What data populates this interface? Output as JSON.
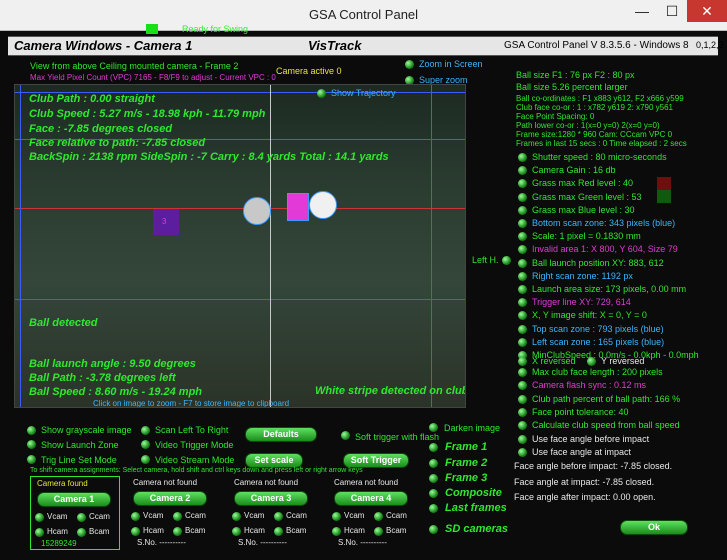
{
  "window": {
    "title": "GSA Control Panel",
    "min": "—",
    "max": "☐",
    "close": "✕"
  },
  "status": {
    "ready": "Ready for Swing"
  },
  "header": {
    "camera_title": "Camera Windows - Camera  1",
    "app_name": "VisTrack",
    "version": "GSA Control Panel V 8.3.5.6 - Windows 8",
    "id": "0,1,2,3"
  },
  "view": {
    "caption": "View from above Ceiling mounted camera - Frame 2",
    "pixel_count": "Max Yield Pixel Count (VPC) 7165  - F8/F9 to adjust - Current VPC : 0",
    "camera_active": "Camera active 0",
    "zoom_screen": "Zoom in Screen",
    "super_zoom": "Super zoom",
    "show_trajectory": "Show Trajectory"
  },
  "overlay": {
    "club_path": "Club Path : 0.00 straight",
    "club_speed": "Club Speed : 5.27 m/s - 18.98 kph - 11.79 mph",
    "face": "Face : -7.85 degrees closed",
    "face_rel": "Face relative to path: -7.85 closed",
    "spin": "BackSpin : 2138 rpm  SideSpin : -7  Carry : 8.4 yards  Total : 14.1 yards",
    "ball_detected": "Ball detected",
    "launch_angle": "Ball launch angle : 9.50 degrees",
    "ball_path": "Ball Path : -3.78 degrees left",
    "ball_speed": "Ball Speed : 8.60 m/s - 19.24 mph",
    "white_stripe": "White stripe detected on club",
    "store_hint": "Click on image to zoom - F7 to store image to clipboard",
    "ball_marker": "1",
    "ball_marker2": "3"
  },
  "info": {
    "ball_size1": "Ball size F1 : 76 px  F2 : 80 px",
    "ball_size2": "Ball size 5.26 percent larger",
    "coords1": "Ball co-ordinates : F1 x883 y612, F2 x666 y599",
    "coords2": "Club face co-or : 1 : x782 y619 2: x790 y561",
    "face_spacing": "Face Point Spacing: 0",
    "path_lower": "Path lower co-or : 1(x=0 y=0) 2(x=0 y=0)",
    "frame_size": "Frame size:1280 * 960 Cam: CCcam VPC 0",
    "frames": "Frames in last 15 secs : 0 Time elapsed : 2 secs"
  },
  "settings": [
    {
      "label": "Shutter speed : 80 micro-seconds",
      "color": "g"
    },
    {
      "label": "Camera Gain : 16 db",
      "color": "g"
    },
    {
      "label": "Grass max Red level : 40",
      "color": "g"
    },
    {
      "label": "Grass max Green level : 53",
      "color": "g"
    },
    {
      "label": "Grass max Blue level : 30",
      "color": "g"
    },
    {
      "label": "Bottom scan zone: 343 pixels (blue)",
      "color": "c"
    },
    {
      "label": "Scale: 1 pixel = 0.1830 mm",
      "color": "g"
    },
    {
      "label": "Invalid area 1: X 800, Y 604, Size 79",
      "color": "m"
    },
    {
      "label": "Ball launch position XY: 883, 612",
      "color": "g"
    },
    {
      "label": "Right scan zone: 1192 px",
      "color": "c"
    },
    {
      "label": "Launch area size: 173 pixels, 0.00 mm",
      "color": "g"
    },
    {
      "label": "Trigger line XY: 729, 614",
      "color": "m"
    },
    {
      "label": "X, Y image shift: X = 0, Y = 0",
      "color": "g"
    },
    {
      "label": "Top scan zone : 793 pixels (blue)",
      "color": "c"
    },
    {
      "label": "Left scan zone : 165 pixels (blue)",
      "color": "c"
    },
    {
      "label": "MinClubSpeed : 0.0m/s - 0.0kph - 0.0mph",
      "color": "g"
    }
  ],
  "left_h": "Left H.",
  "reversed": {
    "x": "X reversed",
    "y": "Y reversed"
  },
  "settings2": [
    {
      "label": "Max club face length : 200 pixels",
      "color": "g"
    },
    {
      "label": "Camera flash sync :  0.12 ms",
      "color": "m"
    },
    {
      "label": "Club path percent of ball path: 166 %",
      "color": "g"
    },
    {
      "label": "Face point tolerance: 40",
      "color": "g"
    },
    {
      "label": "Calculate club speed from ball speed",
      "color": "g"
    },
    {
      "label": "Use face angle before impact",
      "color": "w"
    },
    {
      "label": "Use face angle at impact",
      "color": "w"
    }
  ],
  "face_results": {
    "before": "Face angle before impact:  -7.85 closed.",
    "at": "Face angle at impact:      -7.85 closed.",
    "after": "Face angle after impact:   0.00 open."
  },
  "options": {
    "grayscale": "Show grayscale image",
    "scan_lr": "Scan Left To Right",
    "defaults": "Defaults",
    "soft_flash": "Soft trigger with flash",
    "darken": "Darken image",
    "launch_zone": "Show Launch Zone",
    "video_trigger": "Video Trigger Mode",
    "trig_line": "Trig Line Set Mode",
    "video_stream": "Video Stream Mode",
    "set_scale": "Set scale",
    "soft_trigger": "Soft Trigger",
    "assign_hint": "To shift camera assignments: Select camera, hold shift and ctrl keys down and press left or right arrow keys"
  },
  "frames": {
    "f1": "Frame 1",
    "f2": "Frame 2",
    "f3": "Frame 3",
    "composite": "Composite",
    "last": "Last frames",
    "sd": "SD cameras"
  },
  "cameras": [
    {
      "status": "Camera found",
      "button": "Camera 1",
      "vcam": "Vcam",
      "ccam": "Ccam",
      "hcam": "Hcam",
      "bcam": "Bcam",
      "serial": "15289249"
    },
    {
      "status": "Camera not found",
      "button": "Camera 2",
      "vcam": "Vcam",
      "ccam": "Ccam",
      "hcam": "Hcam",
      "bcam": "Bcam",
      "serial": "S.No. ----------"
    },
    {
      "status": "Camera not found",
      "button": "Camera 3",
      "vcam": "Vcam",
      "ccam": "Ccam",
      "hcam": "Hcam",
      "bcam": "Bcam",
      "serial": "S.No. ----------"
    },
    {
      "status": "Camera not found",
      "button": "Camera 4",
      "vcam": "Vcam",
      "ccam": "Ccam",
      "hcam": "Hcam",
      "bcam": "Bcam",
      "serial": "S.No. ----------"
    }
  ],
  "ok": "Ok"
}
